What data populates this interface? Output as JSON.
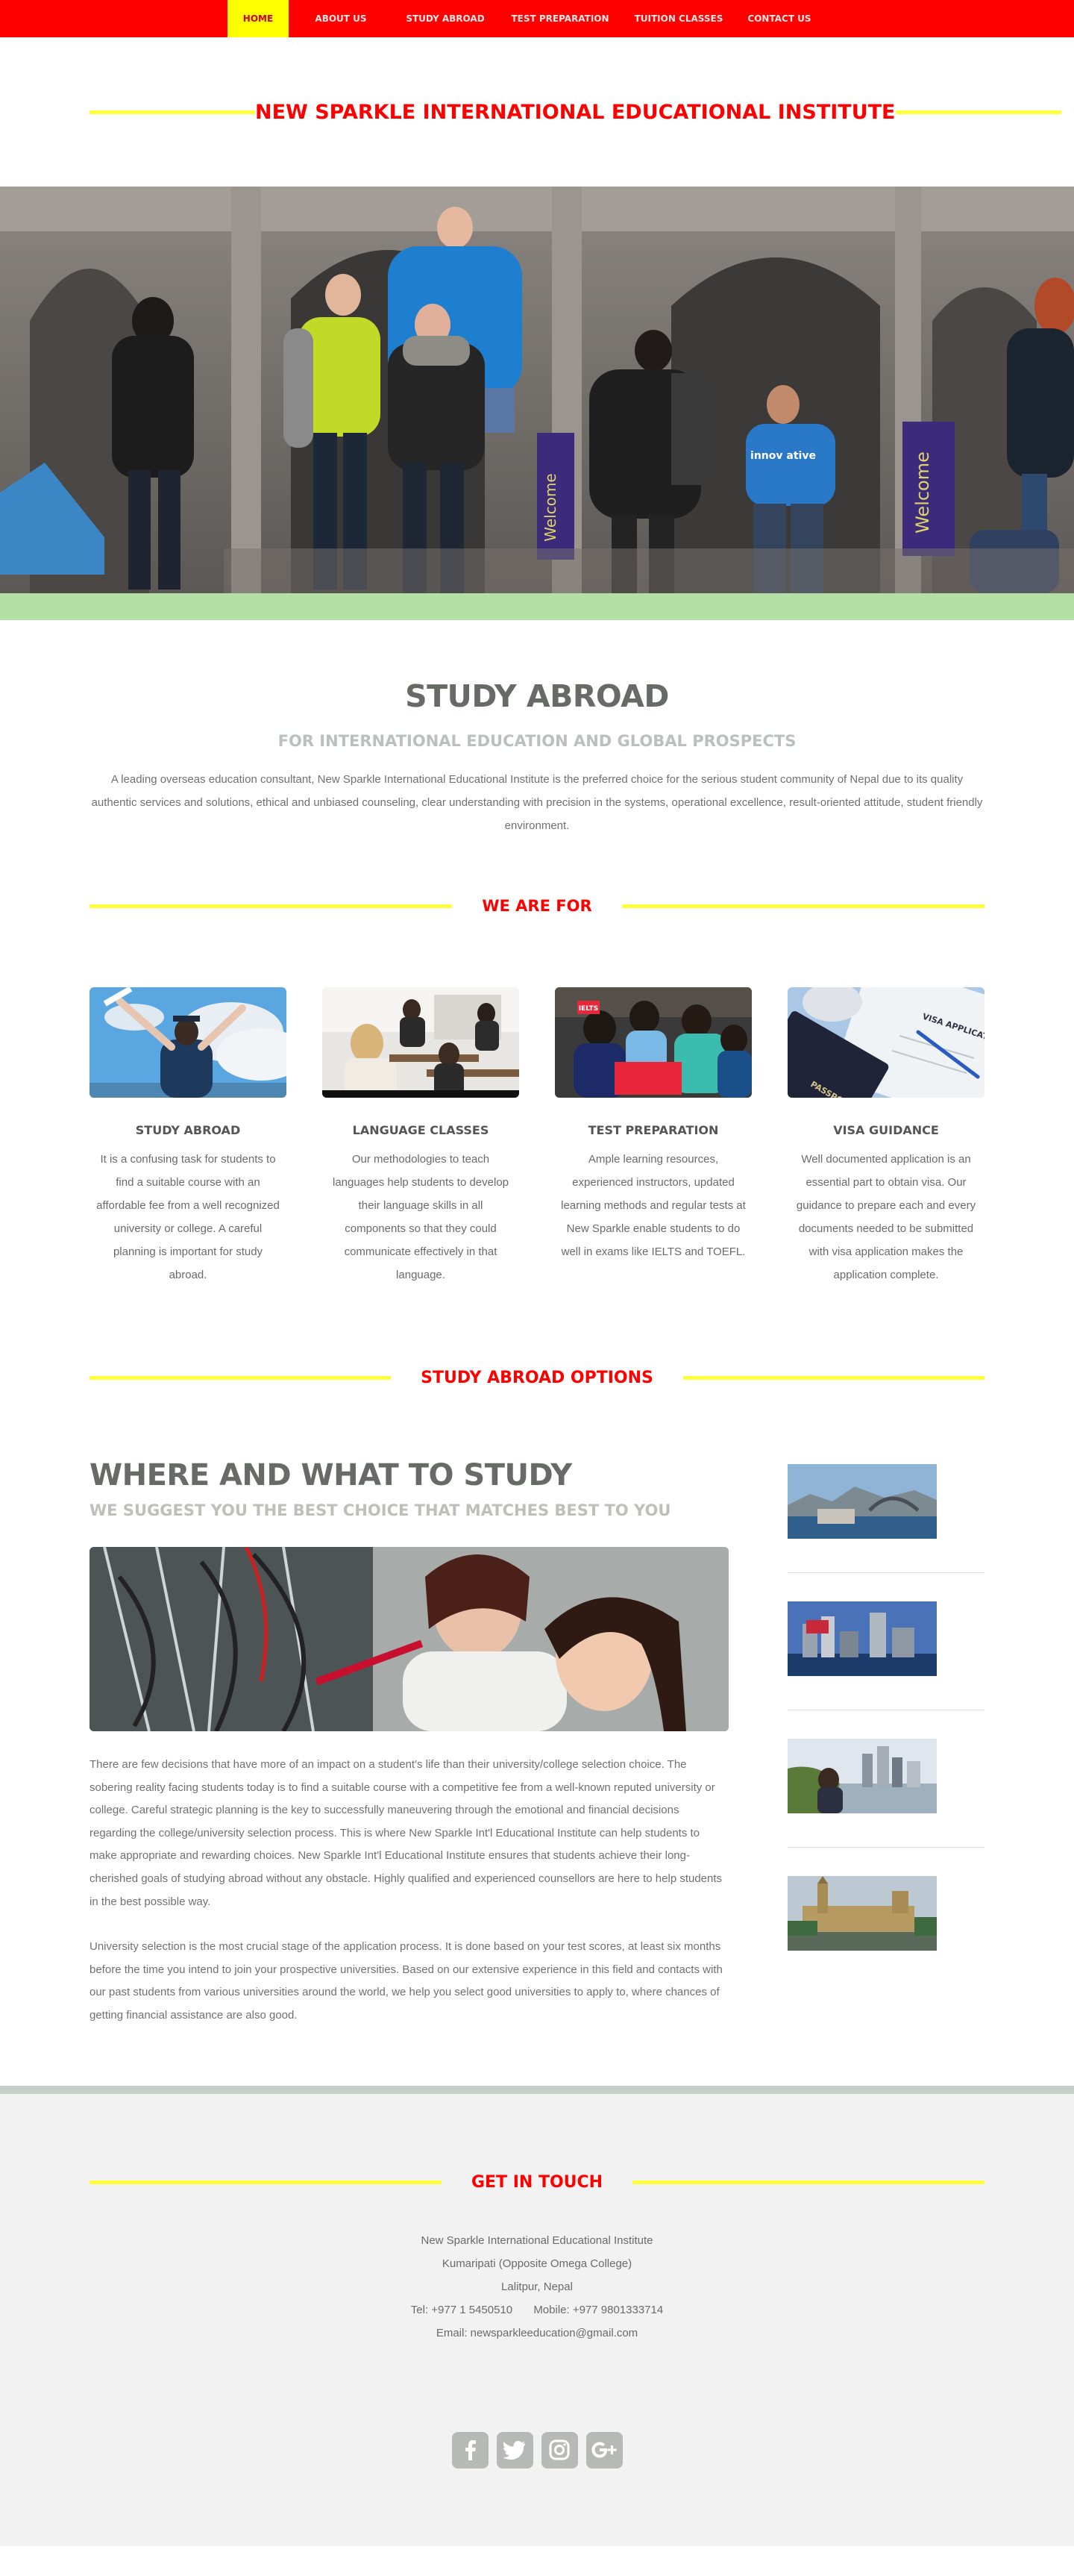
{
  "nav": {
    "items": [
      {
        "label": "HOME",
        "active": true
      },
      {
        "label": "ABOUT US",
        "active": false
      },
      {
        "label": "STUDY ABROAD",
        "active": false
      },
      {
        "label": "TEST PREPARATION",
        "active": false
      },
      {
        "label": "TUITION CLASSES",
        "active": false
      },
      {
        "label": "CONTACT US",
        "active": false
      }
    ]
  },
  "site": {
    "title": "NEW SPARKLE INTERNATIONAL EDUCATIONAL INSTITUTE"
  },
  "hero": {
    "banner_texts": [
      "Welcome",
      "Welcome",
      "innov ative"
    ]
  },
  "intro": {
    "title": "STUDY ABROAD",
    "subtitle": "FOR INTERNATIONAL EDUCATION AND GLOBAL PROSPECTS",
    "text": "A leading overseas education consultant, New Sparkle International Educational Institute is the preferred choice for the serious student community of Nepal due to its quality authentic services and solutions, ethical and unbiased counseling, clear understanding with precision in the systems, operational excellence, result-oriented attitude, student friendly environment."
  },
  "we_are_for": {
    "heading": "WE ARE FOR",
    "cards": [
      {
        "title": "STUDY ABROAD",
        "text": "It is a confusing task for students to find a suitable course with an affordable fee from a well recognized university or college. A careful planning is important for study abroad."
      },
      {
        "title": "LANGUAGE CLASSES",
        "text": "Our methodologies to teach languages help students to develop their language skills in all components so that they could communicate effectively in that language."
      },
      {
        "title": "TEST PREPARATION",
        "text": "Ample learning resources, experienced instructors, updated learning methods and regular tests at New Sparkle enable students to do well in exams like IELTS and TOEFL."
      },
      {
        "title": "VISA GUIDANCE",
        "text": "Well documented application is an essential part to obtain visa. Our guidance to prepare each and every documents needed to be submitted with visa application makes the application complete."
      }
    ],
    "image_labels": {
      "ielts": "IELTS",
      "visa": "VISA APPLICATION",
      "passport": "PASSPORT"
    }
  },
  "options": {
    "heading": "STUDY ABROAD OPTIONS",
    "title": "WHERE AND WHAT TO STUDY",
    "subtitle": "WE SUGGEST YOU THE BEST CHOICE THAT MATCHES BEST TO YOU",
    "paragraphs": [
      "There are few decisions that have more of an impact on a student's life than their university/college selection choice. The sobering reality facing students today is to find a suitable course with a competitive fee from a well-known reputed university or college. Careful strategic planning is the key to successfully maneuvering through the emotional and financial decisions regarding the college/university selection process. This is where New Sparkle Int'l Educational Institute can help students to make appropriate and rewarding choices. New Sparkle Int'l Educational Institute ensures that students achieve their long-cherished goals of studying abroad without any obstacle. Highly qualified and experienced counsellors are here to help students in the best possible way.",
      "University selection is the most crucial stage of the application process. It is done based on your test scores, at least six months before the time you intend to join your prospective universities. Based on our extensive experience in this field and contacts with our past students from various universities around the world, we help you select good universities to apply to, where chances of getting financial assistance are also good."
    ],
    "thumbnails": [
      "sydney-harbour",
      "city-waterfront",
      "riverside-city",
      "westminster-london"
    ]
  },
  "footer": {
    "heading": "GET IN TOUCH",
    "org": "New Sparkle International Educational Institute",
    "address1": "Kumaripati (Opposite Omega College)",
    "address2": "Lalitpur, Nepal",
    "tel": "Tel: +977 1 5450510",
    "mobile": "Mobile: +977 9801333714",
    "email": "Email: newsparkleeducation@gmail.com",
    "social": [
      "facebook-icon",
      "twitter-icon",
      "instagram-icon",
      "google-plus-icon"
    ]
  },
  "colors": {
    "nav_bg": "#ff0000",
    "nav_active_bg": "#ffff00",
    "accent_red": "#ff0000",
    "accent_yellow_line": "#ffff3a",
    "green_bar": "#b4e0a6",
    "footer_bg": "#f1f2f1"
  }
}
